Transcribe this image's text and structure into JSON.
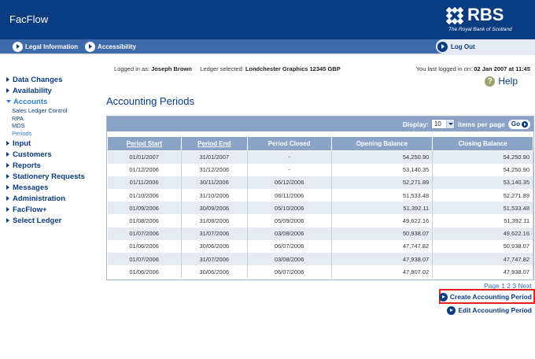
{
  "header": {
    "app_title": "FacFlow",
    "logo_text": "RBS",
    "logo_subtitle": "The Royal Bank of Scotland",
    "brand_color": "#0a3c82"
  },
  "nav": {
    "legal": "Legal Information",
    "accessibility": "Accessibility",
    "logout": "Log Out"
  },
  "session": {
    "logged_in_label": "Logged in as:",
    "user": "Joseph Brown",
    "ledger_label": "Ledger selected:",
    "ledger": "Londchester Graphics 12345 GBP",
    "last_login_label": "You last logged in on:",
    "last_login": "02 Jan 2007 at 11:45"
  },
  "help": {
    "icon": "?",
    "label": "Help"
  },
  "sidebar": {
    "items": [
      {
        "label": "Data Changes"
      },
      {
        "label": "Availability"
      },
      {
        "label": "Accounts",
        "expanded": true,
        "children": [
          "Sales Ledger Control",
          "RPA",
          "MDS",
          "Periods"
        ]
      },
      {
        "label": "Input"
      },
      {
        "label": "Customers"
      },
      {
        "label": "Reports"
      },
      {
        "label": "Stationery Requests"
      },
      {
        "label": "Messages"
      },
      {
        "label": "Administration"
      },
      {
        "label": "FacFlow+"
      },
      {
        "label": "Select Ledger"
      }
    ]
  },
  "page": {
    "title": "Accounting Periods",
    "display_label": "Display:",
    "display_value": "10",
    "per_page_label": "items per page",
    "go_label": "Go"
  },
  "table": {
    "headers": [
      "Period Start",
      "Period End",
      "Period Closed",
      "Opening Balance",
      "Closing Balance"
    ],
    "rows": [
      [
        "01/01/2007",
        "31/01/2007",
        "-",
        "54,250.90",
        "54,250.90"
      ],
      [
        "01/12/2006",
        "31/12/2006",
        "-",
        "53,140.35",
        "54,250.90"
      ],
      [
        "01/11/2006",
        "30/11/2006",
        "06/12/2006",
        "52,271.89",
        "53,140.35"
      ],
      [
        "01/10/2006",
        "31/10/2006",
        "06/11/2006",
        "51,533.48",
        "52,271.89"
      ],
      [
        "01/09/2006",
        "30/09/2006",
        "05/10/2006",
        "51,392.11",
        "51,533.48"
      ],
      [
        "01/08/2006",
        "31/08/2006",
        "05/09/2006",
        "49,622.16",
        "51,392.11"
      ],
      [
        "01/07/2006",
        "31/07/2006",
        "03/08/2006",
        "50,938.07",
        "49,622.16"
      ],
      [
        "01/06/2006",
        "30/06/2006",
        "06/07/2006",
        "47,747.82",
        "50,938.07"
      ],
      [
        "01/07/2006",
        "31/07/2006",
        "03/08/2006",
        "47,938.07",
        "47,747.82"
      ],
      [
        "01/06/2006",
        "30/06/2006",
        "06/07/2006",
        "47,807.02",
        "47,938.07"
      ]
    ]
  },
  "pager": {
    "label": "Page",
    "pages": [
      "1",
      "2",
      "3"
    ],
    "next": "Next"
  },
  "actions": {
    "create": "Create Accounting Period",
    "edit": "Edit Accounting Period",
    "highlight_color": "#e0241b"
  }
}
